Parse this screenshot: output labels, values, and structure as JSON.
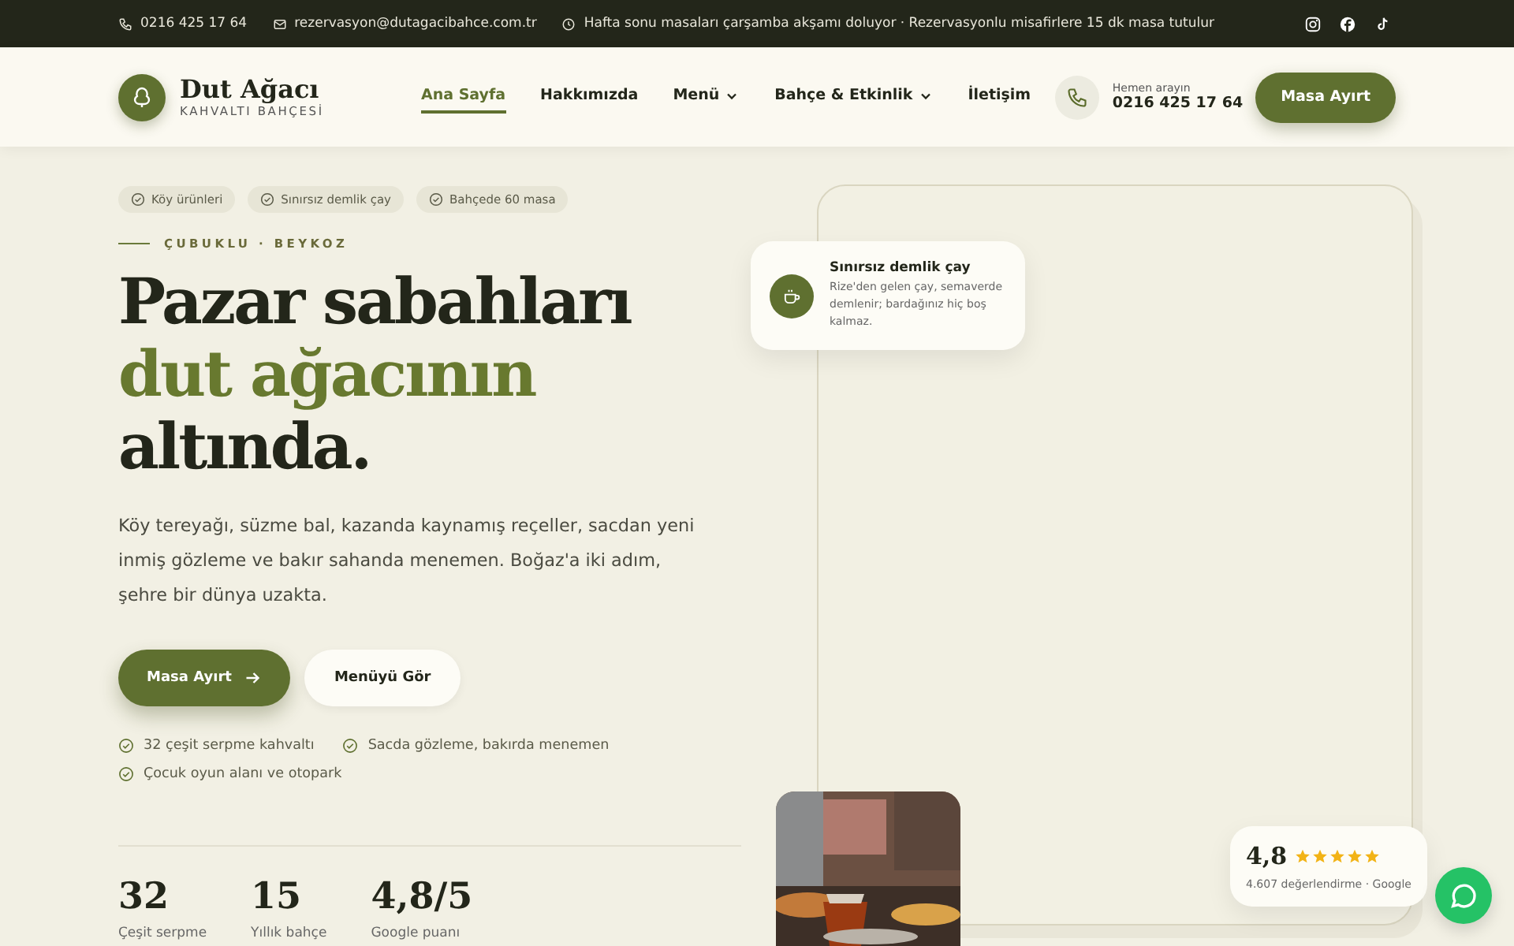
{
  "topbar": {
    "phone": "0216 425 17 64",
    "email": "rezervasyon@dutagacibahce.com.tr",
    "notice": "Hafta sonu masaları çarşamba akşamı doluyor · Rezervasyonlu misafirlere 15 dk masa tutulur"
  },
  "header": {
    "brand": "Dut Ağacı",
    "tagline": "KAHVALTI BAHÇESİ",
    "nav": [
      {
        "label": "Ana Sayfa",
        "selected": true,
        "dropdown": false
      },
      {
        "label": "Hakkımızda",
        "selected": false,
        "dropdown": false
      },
      {
        "label": "Menü",
        "selected": false,
        "dropdown": true
      },
      {
        "label": "Bahçe & Etkinlik",
        "selected": false,
        "dropdown": true
      },
      {
        "label": "İletişim",
        "selected": false,
        "dropdown": false
      }
    ],
    "call_label": "Hemen arayın",
    "call_number": "0216 425 17 64",
    "cta": "Masa Ayırt"
  },
  "hero": {
    "chips": [
      "Köy ürünleri",
      "Sınırsız demlik çay",
      "Bahçede 60 masa"
    ],
    "eyebrow": "ÇUBUKLU · BEYKOZ",
    "title_lines": [
      {
        "text": "Pazar sabahları",
        "accent": false
      },
      {
        "text": "dut ağacının",
        "accent": true
      },
      {
        "text": "altında.",
        "accent": false
      }
    ],
    "lead": "Köy tereyağı, süzme bal, kazanda kaynamış reçeller, sacdan yeni inmiş gözleme ve bakır sahanda menemen. Boğaz'a iki adım, şehre bir dünya uzakta.",
    "primary_button": "Masa Ayırt",
    "secondary_button": "Menüyü Gör",
    "features": [
      "32 çeşit serpme kahvaltı",
      "Sacda gözleme, bakırda menemen",
      "Çocuk oyun alanı ve otopark"
    ],
    "stats": [
      {
        "value": "32",
        "label": "Çeşit serpme"
      },
      {
        "value": "15",
        "label": "Yıllık bahçe"
      },
      {
        "value": "4,8/5",
        "label": "Google puanı"
      }
    ]
  },
  "tea_card": {
    "title": "Sınırsız demlik çay",
    "text": "Rize'den gelen çay, semaverde demlenir; bardağınız hiç boş kalmaz."
  },
  "rating": {
    "score": "4,8",
    "stars": 5,
    "caption": "4.607 değerlendirme · Google"
  }
}
